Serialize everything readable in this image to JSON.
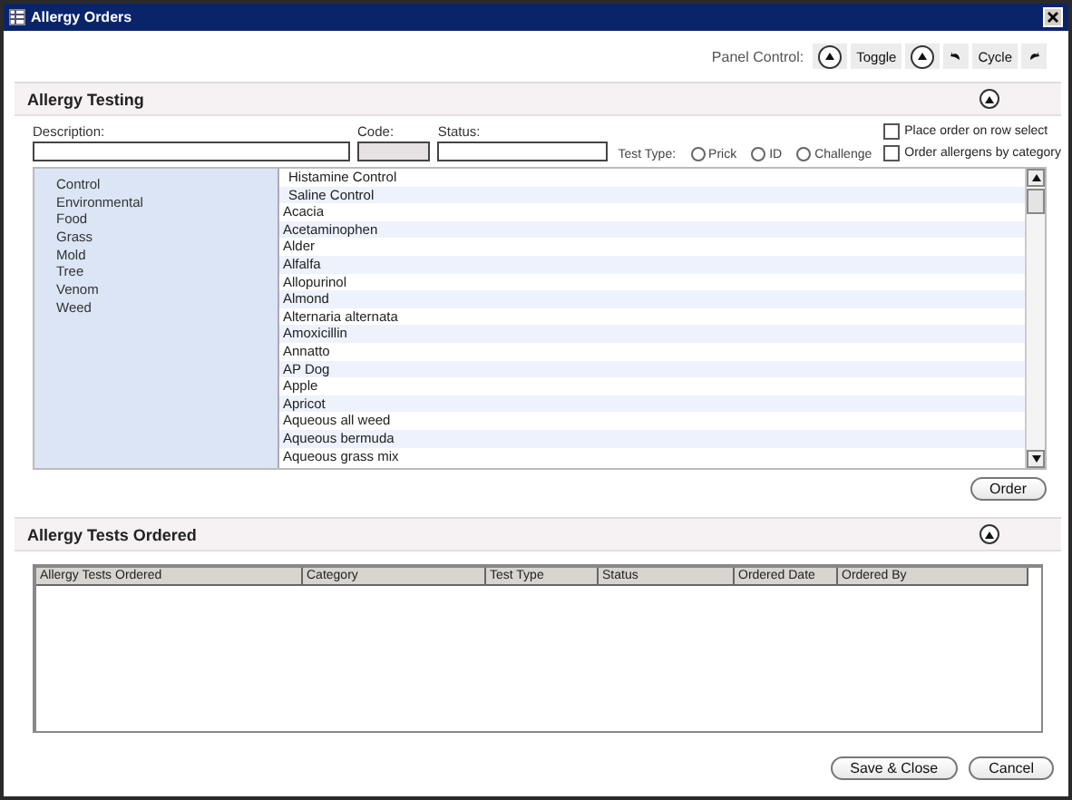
{
  "window": {
    "title": "Allergy Orders"
  },
  "panel_control": {
    "label": "Panel Control:",
    "toggle": "Toggle",
    "cycle": "Cycle"
  },
  "allergy_testing": {
    "title": "Allergy Testing",
    "expanded": true,
    "fields": [
      {
        "label": "Description:",
        "disabled": false
      },
      {
        "label": "Code:",
        "disabled": true
      },
      {
        "label": "Status:",
        "disabled": false
      }
    ],
    "test_type": {
      "label": "Test Type:",
      "options": [
        {
          "label": "Prick",
          "selected": false
        },
        {
          "label": "ID",
          "selected": false
        },
        {
          "label": "Challenge",
          "selected": false
        }
      ]
    },
    "checkboxes": [
      {
        "label": "Place order on row select",
        "checked": false
      },
      {
        "label": "Order allergens by category",
        "checked": false
      }
    ],
    "categories": [
      "Control",
      "Environmental",
      "Food",
      "Grass",
      "Mold",
      "Tree",
      "Venom",
      "Weed"
    ],
    "allergens": [
      "Histamine Control",
      "Saline Control",
      "Acacia",
      "Acetaminophen",
      "Alder",
      "Alfalfa",
      "Allopurinol",
      "Almond",
      "Alternaria alternata",
      "Amoxicillin",
      "Annatto",
      "AP Dog",
      "Apple",
      "Apricot",
      "Aqueous all weed",
      "Aqueous bermuda",
      "Aqueous grass mix"
    ],
    "order_button": "Order"
  },
  "allergy_tests_ordered": {
    "title": "Allergy Tests Ordered",
    "expanded": true,
    "columns": [
      "Allergy Tests Ordered",
      "Category",
      "Test Type",
      "Status",
      "Ordered Date",
      "Ordered By"
    ]
  },
  "buttons": [
    "Save & Close",
    "Cancel"
  ]
}
